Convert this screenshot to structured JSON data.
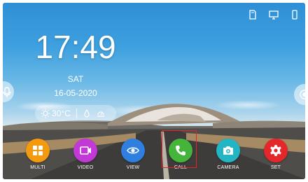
{
  "status": {
    "icons": [
      "sd-card-icon",
      "display-icon",
      "phone-icon"
    ]
  },
  "clock": {
    "time": "17:49",
    "day": "SAT",
    "date": "16-05-2020"
  },
  "weather": {
    "temperature": "30°C",
    "icons": [
      "sun-icon",
      "humidity-icon",
      "wind-icon"
    ]
  },
  "dock": {
    "apps": [
      {
        "label": "MULTI",
        "icon": "grid-icon",
        "color": "#f39a0f"
      },
      {
        "label": "VIDEO",
        "icon": "video-icon",
        "color": "#c13ad6"
      },
      {
        "label": "VIEW",
        "icon": "eye-icon",
        "color": "#2f7fe0"
      },
      {
        "label": "CALL",
        "icon": "phone-icon",
        "color": "#44b53a"
      },
      {
        "label": "CAMERA",
        "icon": "camera-icon",
        "color": "#22b6c4"
      },
      {
        "label": "SET",
        "icon": "gear-icon",
        "color": "#e3272b"
      }
    ],
    "selected": "CALL"
  },
  "colors": {
    "selection_outline": "#e0242a",
    "sky_top": "#2f8fd6"
  }
}
